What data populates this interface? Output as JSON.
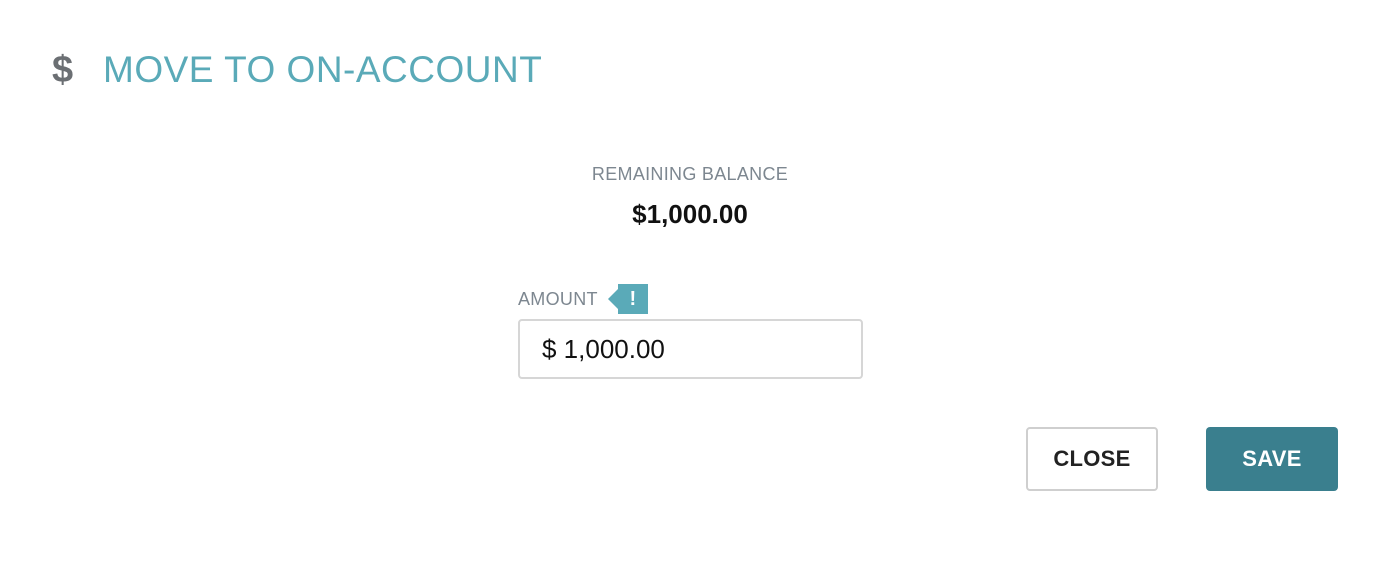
{
  "header": {
    "icon": "dollar-icon",
    "icon_glyph": "$",
    "title": "MOVE TO ON-ACCOUNT"
  },
  "balance": {
    "label": "REMAINING BALANCE",
    "value": "$1,000.00"
  },
  "amount": {
    "label": "AMOUNT",
    "alert_icon": "exclamation-icon",
    "alert_glyph": "!",
    "value": "$ 1,000.00"
  },
  "buttons": {
    "close_label": "CLOSE",
    "save_label": "SAVE"
  },
  "colors": {
    "accent": "#5aaab8",
    "primary_button": "#3a7f8e",
    "muted_text": "#7d8790"
  }
}
